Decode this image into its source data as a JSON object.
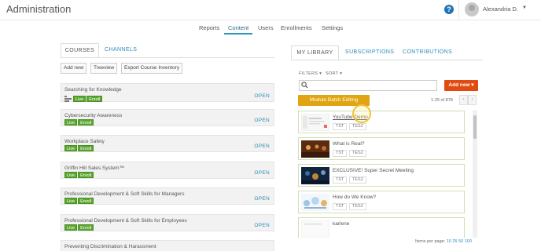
{
  "header": {
    "title": "Administration",
    "help_icon": "question-circle-icon",
    "user_name": "Alexandria D."
  },
  "topnav": {
    "items": [
      "Reports",
      "Content",
      "Users",
      "Enrollments",
      "Settings"
    ],
    "active": "Content",
    "accent": "#2c95b8"
  },
  "left": {
    "tabs": [
      "COURSES",
      "CHANNELS"
    ],
    "buttons": [
      "Add new",
      "Treeview",
      "Export Course Inventory"
    ],
    "courses": [
      {
        "title": "Searching for Knowledge",
        "badges": [
          "Live",
          "Enroll"
        ],
        "open": "OPEN"
      },
      {
        "title": "Cybersecurity Awareness",
        "badges": [
          "Live",
          "Enroll"
        ],
        "open": "OPEN"
      },
      {
        "title": "Workplace Safety",
        "badges": [
          "Live",
          "Enroll"
        ],
        "open": "OPEN"
      },
      {
        "title": "Griffin Hill Sales System™",
        "badges": [
          "Live",
          "Enroll"
        ],
        "open": "OPEN"
      },
      {
        "title": "Professional Development & Soft Skills for Managers",
        "badges": [
          "Live",
          "Enroll"
        ],
        "open": "OPEN"
      },
      {
        "title": "Professional Development & Soft Skills for Employees",
        "badges": [
          "Live",
          "Enroll"
        ],
        "open": "OPEN"
      },
      {
        "title": "Preventing Discrimination & Harassment",
        "badges": [],
        "open": ""
      }
    ]
  },
  "right": {
    "tabs": [
      "MY LIBRARY",
      "SUBSCRIPTIONS",
      "CONTRIBUTIONS"
    ],
    "filters": "FILTERS ▾",
    "sort": "SORT ▾",
    "search_placeholder": "",
    "add_new": "Add new ▾",
    "batch_button": "Module Batch Editing",
    "range": "1-25 of 878",
    "prev": "‹",
    "next": "›",
    "items": [
      {
        "title": "YouTube Demo",
        "tags": [
          "TST",
          "TES2"
        ]
      },
      {
        "title": "What is Real?",
        "tags": [
          "TST",
          "TES2"
        ]
      },
      {
        "title": "EXCLUSIVE! Super Secret Meeting",
        "tags": [
          "TST",
          "TES2"
        ]
      },
      {
        "title": "How do We Know?",
        "tags": [
          "TST",
          "TES2"
        ]
      },
      {
        "title": "karlene",
        "tags": []
      }
    ],
    "per_page_label": "Items per page:",
    "per_page_options": [
      "10",
      "25",
      "50",
      "100"
    ]
  },
  "colors": {
    "live_badge": "#5aa72f",
    "add_new": "#e24a12",
    "batch": "#e0a510",
    "link": "#2a8db7"
  }
}
